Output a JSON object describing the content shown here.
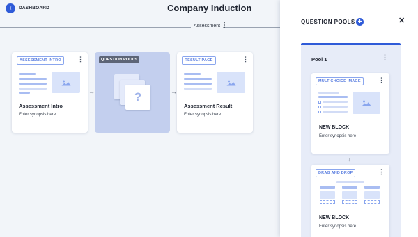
{
  "header": {
    "back_label": "DASHBOARD",
    "title": "Company Induction",
    "tab_label": "Assessment"
  },
  "flow": {
    "intro": {
      "tag": "ASSESSMENT INTRO",
      "title": "Assessment Intro",
      "synopsis": "Enter synopsis here"
    },
    "pools": {
      "tag": "QUESTION POOLS",
      "glyph": "?"
    },
    "result": {
      "tag": "RESULT PAGE",
      "title": "Assessment Result",
      "synopsis": "Enter synopsis here"
    }
  },
  "panel": {
    "title": "QUESTION POOLS",
    "add_glyph": "+",
    "close_glyph": "✕",
    "pool": {
      "name": "Pool 1",
      "blocks": [
        {
          "tag": "MULTICHOICE IMAGE",
          "title": "NEW BLOCK",
          "synopsis": "Enter synopsis here"
        },
        {
          "tag": "DRAG AND DROP",
          "title": "NEW BLOCK",
          "synopsis": "Enter synopsis here"
        }
      ]
    }
  },
  "icons": {
    "back": "‹",
    "kebab": "⋮",
    "arrow_right": "→",
    "arrow_down": "↓"
  },
  "colors": {
    "accent": "#2f5bd8",
    "tag_text": "#5b7fe0",
    "placeholder": "#a9bdf2",
    "pool_card": "#c3cfee"
  }
}
